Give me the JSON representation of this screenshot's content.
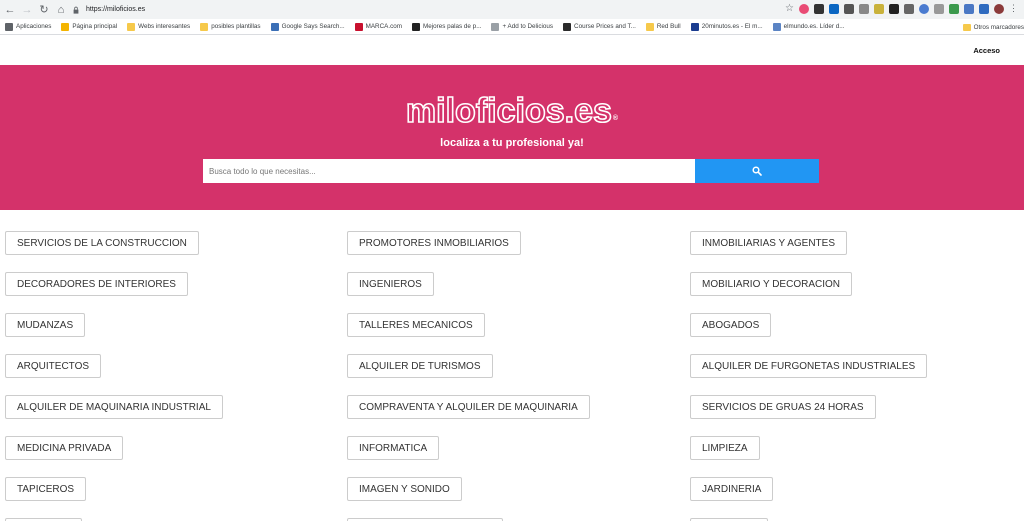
{
  "browser": {
    "url": "https://miloficios.es",
    "bookmarks": [
      {
        "label": "Aplicaciones",
        "color": "#5f6368"
      },
      {
        "label": "Página principal",
        "color": "#f4b400"
      },
      {
        "label": "Webs interesantes",
        "color": "#f6c94b"
      },
      {
        "label": "posibles plantillas",
        "color": "#f6c94b"
      },
      {
        "label": "Google Says Search...",
        "color": "#3b6fb6"
      },
      {
        "label": "MARCA.com",
        "color": "#c8102e"
      },
      {
        "label": "Mejores palas de p...",
        "color": "#222222"
      },
      {
        "label": "+ Add to Delicious",
        "color": "#9aa0a6"
      },
      {
        "label": "Course Prices and T...",
        "color": "#2b2b2b"
      },
      {
        "label": "Red Bull",
        "color": "#f6c94b"
      },
      {
        "label": "20minutos.es - El m...",
        "color": "#1a3c8f"
      },
      {
        "label": "elmundo.es. Líder d...",
        "color": "#5b84c4"
      }
    ],
    "other_bookmarks": "Otros marcadores"
  },
  "site": {
    "login_label": "Acceso",
    "logo_text": "miloficios.es",
    "logo_mark": "®",
    "tagline": "localiza a tu profesional ya!",
    "search_placeholder": "Busca todo lo que necesitas...",
    "colors": {
      "brand": "#d4326a",
      "search_button": "#2196f3"
    }
  },
  "categories": {
    "col1": [
      "SERVICIOS DE LA CONSTRUCCION",
      "DECORADORES DE INTERIORES",
      "MUDANZAS",
      "ARQUITECTOS",
      "ALQUILER DE MAQUINARIA INDUSTRIAL",
      "MEDICINA PRIVADA",
      "TAPICEROS"
    ],
    "col2": [
      "PROMOTORES INMOBILIARIOS",
      "INGENIEROS",
      "TALLERES MECANICOS",
      "ALQUILER DE TURISMOS",
      "COMPRAVENTA Y ALQUILER DE MAQUINARIA",
      "INFORMATICA",
      "IMAGEN Y SONIDO"
    ],
    "col3": [
      "INMOBILIARIAS Y AGENTES",
      "MOBILIARIO Y DECORACION",
      "ABOGADOS",
      "ALQUILER DE FURGONETAS INDUSTRIALES",
      "SERVICIOS DE GRUAS 24 HORAS",
      "LIMPIEZA",
      "JARDINERIA"
    ]
  }
}
